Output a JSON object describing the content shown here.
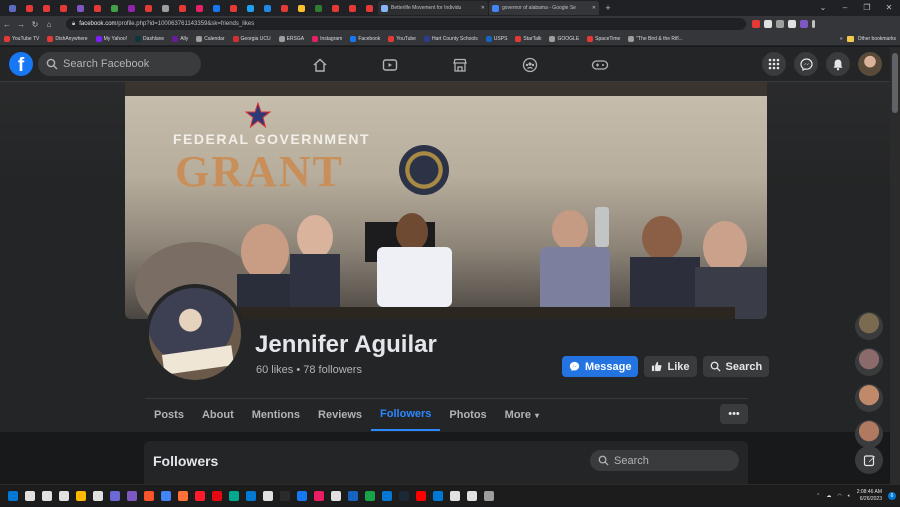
{
  "browser": {
    "tabs": [
      {
        "title": "Betterlife Movement for Individu",
        "color": "#8ab4f8",
        "active": false
      },
      {
        "title": "governor of alabama - Google Se",
        "color": "#4285f4",
        "active": true
      }
    ],
    "small_tab_colors": [
      "#5c6bc0",
      "#e53935",
      "#e53935",
      "#e53935",
      "#7e57c2",
      "#e53935",
      "#43a047",
      "#8e24aa",
      "#e53935",
      "#9e9e9e",
      "#e53935",
      "#e91e63",
      "#1877f2",
      "#e53935",
      "#1da1f2",
      "#1e88e5",
      "#e53935",
      "#fbc02d",
      "#2e7d32",
      "#e53935",
      "#e53935",
      "#e53935"
    ],
    "url_domain": "facebook.com",
    "url_path": "/profile.php?id=100063761143359&sk=friends_likes",
    "bookmarks": [
      {
        "label": "YouTube TV",
        "color": "#e53935"
      },
      {
        "label": "DishAnywhere",
        "color": "#e53935"
      },
      {
        "label": "My Yahoo!",
        "color": "#7e1fff"
      },
      {
        "label": "Dashlane",
        "color": "#0e353d"
      },
      {
        "label": "Ally",
        "color": "#6a1b9a"
      },
      {
        "label": "Calendar",
        "color": "#9e9e9e"
      },
      {
        "label": "Georgia UCU",
        "color": "#d32f2f"
      },
      {
        "label": "ERSGA",
        "color": "#9e9e9e"
      },
      {
        "label": "Instagram",
        "color": "#e91e63"
      },
      {
        "label": "Facebook",
        "color": "#1877f2"
      },
      {
        "label": "YouTube",
        "color": "#e53935"
      },
      {
        "label": "Hart County Schools",
        "color": "#2e3b8f"
      },
      {
        "label": "USPS",
        "color": "#1565c0"
      },
      {
        "label": "StarTalk",
        "color": "#e53935"
      },
      {
        "label": "GOOGLE",
        "color": "#9e9e9e"
      },
      {
        "label": "SpaceTime",
        "color": "#e53935"
      },
      {
        "label": "\"The Bird & the Rifl...",
        "color": "#9e9e9e"
      }
    ],
    "other_bookmarks": "Other bookmarks"
  },
  "fb": {
    "search_placeholder": "Search Facebook",
    "logo_letter": "f",
    "nav_icons": [
      "home-icon",
      "video-icon",
      "marketplace-icon",
      "groups-icon",
      "gaming-icon"
    ],
    "right_icons": [
      "menu-grid-icon",
      "messenger-icon",
      "notifications-icon"
    ]
  },
  "cover": {
    "line1": "FEDERAL GOVERNMENT",
    "line2": "GRANT"
  },
  "profile": {
    "name": "Jennifer Aguilar",
    "stats": "60 likes • 78 followers",
    "buttons": {
      "message": "Message",
      "like": "Like",
      "search": "Search"
    },
    "tabs": [
      "Posts",
      "About",
      "Mentions",
      "Reviews",
      "Followers",
      "Photos",
      "More"
    ],
    "active_tab": "Followers",
    "more_menu": "•••"
  },
  "followers_section": {
    "title": "Followers",
    "search_placeholder": "Search"
  },
  "chat_heads": [
    "#7a6a50",
    "#8a6a6a",
    "#c08a6a",
    "#b07a60"
  ],
  "taskbar": {
    "icon_colors": [
      "#0078d4",
      "#e0e0e0",
      "#e0e0e0",
      "#e0e0e0",
      "#ffb900",
      "#e0e0e0",
      "#6b69d6",
      "#7e57c2",
      "#fb542b",
      "#4285f4",
      "#ff7139",
      "#ff1b2d",
      "#e50914",
      "#00a88e",
      "#0078d4",
      "#e0e0e0",
      "#2b2b2b",
      "#1877f2",
      "#e91e63",
      "#e0e0e0",
      "#1565c0",
      "#16a34a",
      "#0078d4",
      "#1b2838",
      "#ff0000",
      "#0078d4",
      "#e0e0e0",
      "#e0e0e0",
      "#9e9e9e"
    ],
    "time": "2:08:46 AM",
    "date": "6/26/2023",
    "notif_count": "6"
  }
}
